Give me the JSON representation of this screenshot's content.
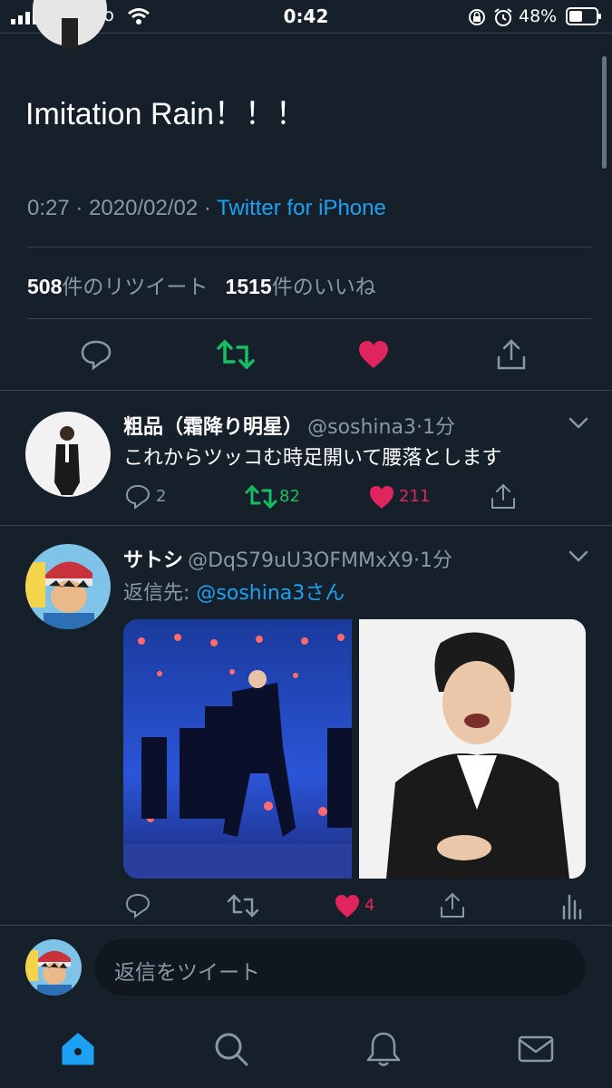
{
  "status_bar": {
    "carrier": "docomo",
    "time": "0:42",
    "battery": "48%"
  },
  "tweet": {
    "text": "Imitation Rain！！！",
    "time": "0:27",
    "date": "2020/02/02",
    "client": "Twitter for iPhone",
    "retweets": "508",
    "retweets_label": "件のリツイート",
    "likes": "1515",
    "likes_label": "件のいいね"
  },
  "replies": [
    {
      "name": "粗品（霜降り明星）",
      "handle": "@soshina3",
      "time": "1分",
      "text": "これからツッコむ時足開いて腰落とします",
      "reply_count": "2",
      "retweet_count": "82",
      "like_count": "211"
    },
    {
      "name": "サトシ",
      "handle": "@DqS79uU3OFMMxX9",
      "time": "1分",
      "reply_to_label": "返信先: ",
      "reply_to": "@soshina3さん",
      "like_count": "4"
    }
  ],
  "composer": {
    "placeholder": "返信をツイート"
  },
  "colors": {
    "background": "#15202b",
    "accent": "#1da1f2",
    "retweet": "#17bf63",
    "like": "#e0245e",
    "muted": "#8899a6"
  },
  "icons": [
    "reply-icon",
    "retweet-icon",
    "heart-icon",
    "share-icon",
    "analytics-icon",
    "chevron-down-icon",
    "home-icon",
    "search-icon",
    "notifications-icon",
    "messages-icon"
  ]
}
